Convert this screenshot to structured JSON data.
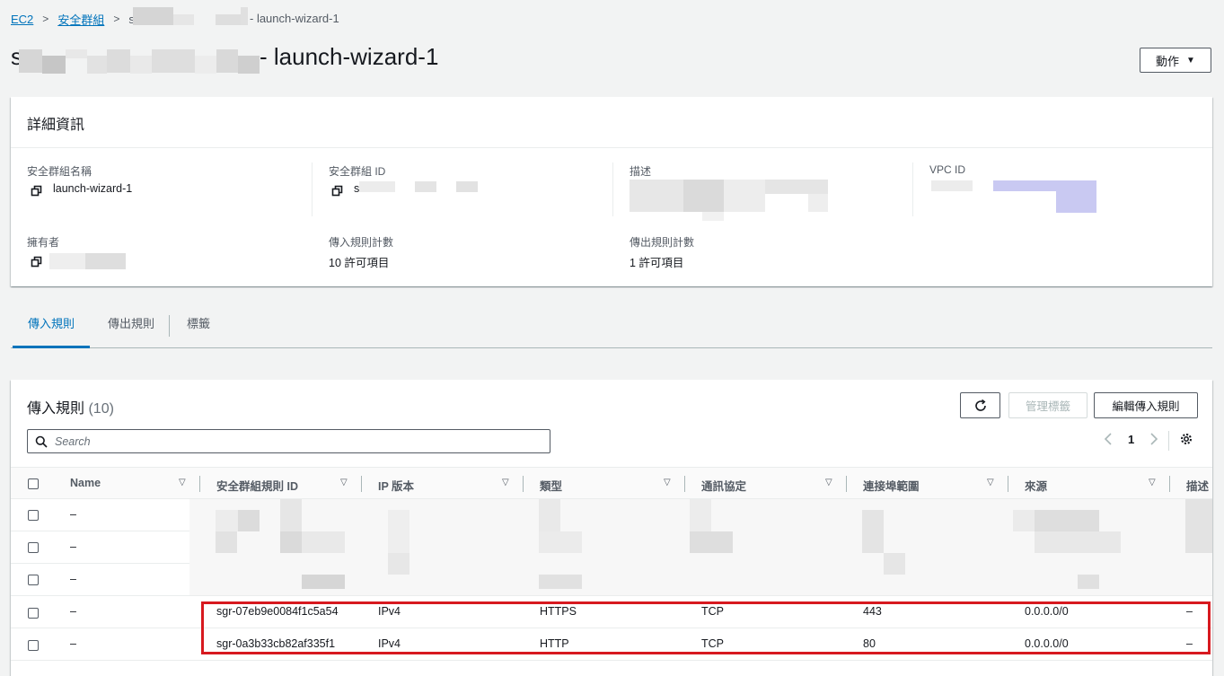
{
  "breadcrumb": {
    "items": [
      "EC2",
      "安全群組"
    ],
    "current_suffix": "- launch-wizard-1",
    "current_prefix": "s"
  },
  "page": {
    "title_prefix": "s",
    "title_suffix": "- launch-wizard-1",
    "actions_label": "動作"
  },
  "details": {
    "title": "詳細資訊",
    "fields": {
      "sg_name_label": "安全群組名稱",
      "sg_name_value": "launch-wizard-1",
      "sg_id_label": "安全群組 ID",
      "sg_id_value_prefix": "s",
      "description_label": "描述",
      "vpc_id_label": "VPC ID",
      "owner_label": "擁有者",
      "inbound_count_label": "傳入規則計數",
      "inbound_count_value": "10 許可項目",
      "outbound_count_label": "傳出規則計數",
      "outbound_count_value": "1 許可項目"
    }
  },
  "tabs": [
    "傳入規則",
    "傳出規則",
    "標籤"
  ],
  "rules": {
    "title": "傳入規則",
    "count": "(10)",
    "manage_tags_label": "管理標籤",
    "edit_label": "編輯傳入規則",
    "search_placeholder": "Search",
    "page_number": "1",
    "columns": [
      "Name",
      "安全群組規則 ID",
      "IP 版本",
      "類型",
      "通訊協定",
      "連接埠範圍",
      "來源",
      "描述"
    ],
    "rows": [
      {
        "name": "–",
        "id": "",
        "ip": "",
        "type": "",
        "proto": "",
        "port": "",
        "source": "",
        "desc": ""
      },
      {
        "name": "–",
        "id": "",
        "ip": "",
        "type": "",
        "proto": "",
        "port": "",
        "source": "",
        "desc": ""
      },
      {
        "name": "–",
        "id": "",
        "ip": "",
        "type": "",
        "proto": "",
        "port": "",
        "source": "",
        "desc": ""
      },
      {
        "name": "–",
        "id": "sgr-07eb9e0084f1c5a54",
        "ip": "IPv4",
        "type": "HTTPS",
        "proto": "TCP",
        "port": "443",
        "source": "0.0.0.0/0",
        "desc": "–"
      },
      {
        "name": "–",
        "id": "sgr-0a3b33cb82af335f1",
        "ip": "IPv4",
        "type": "HTTP",
        "proto": "TCP",
        "port": "80",
        "source": "0.0.0.0/0",
        "desc": "–"
      }
    ]
  },
  "colors": {
    "link": "#0073bb",
    "highlight_box": "#d7191f",
    "vpc_link_redacted": "#c9c9f2"
  }
}
